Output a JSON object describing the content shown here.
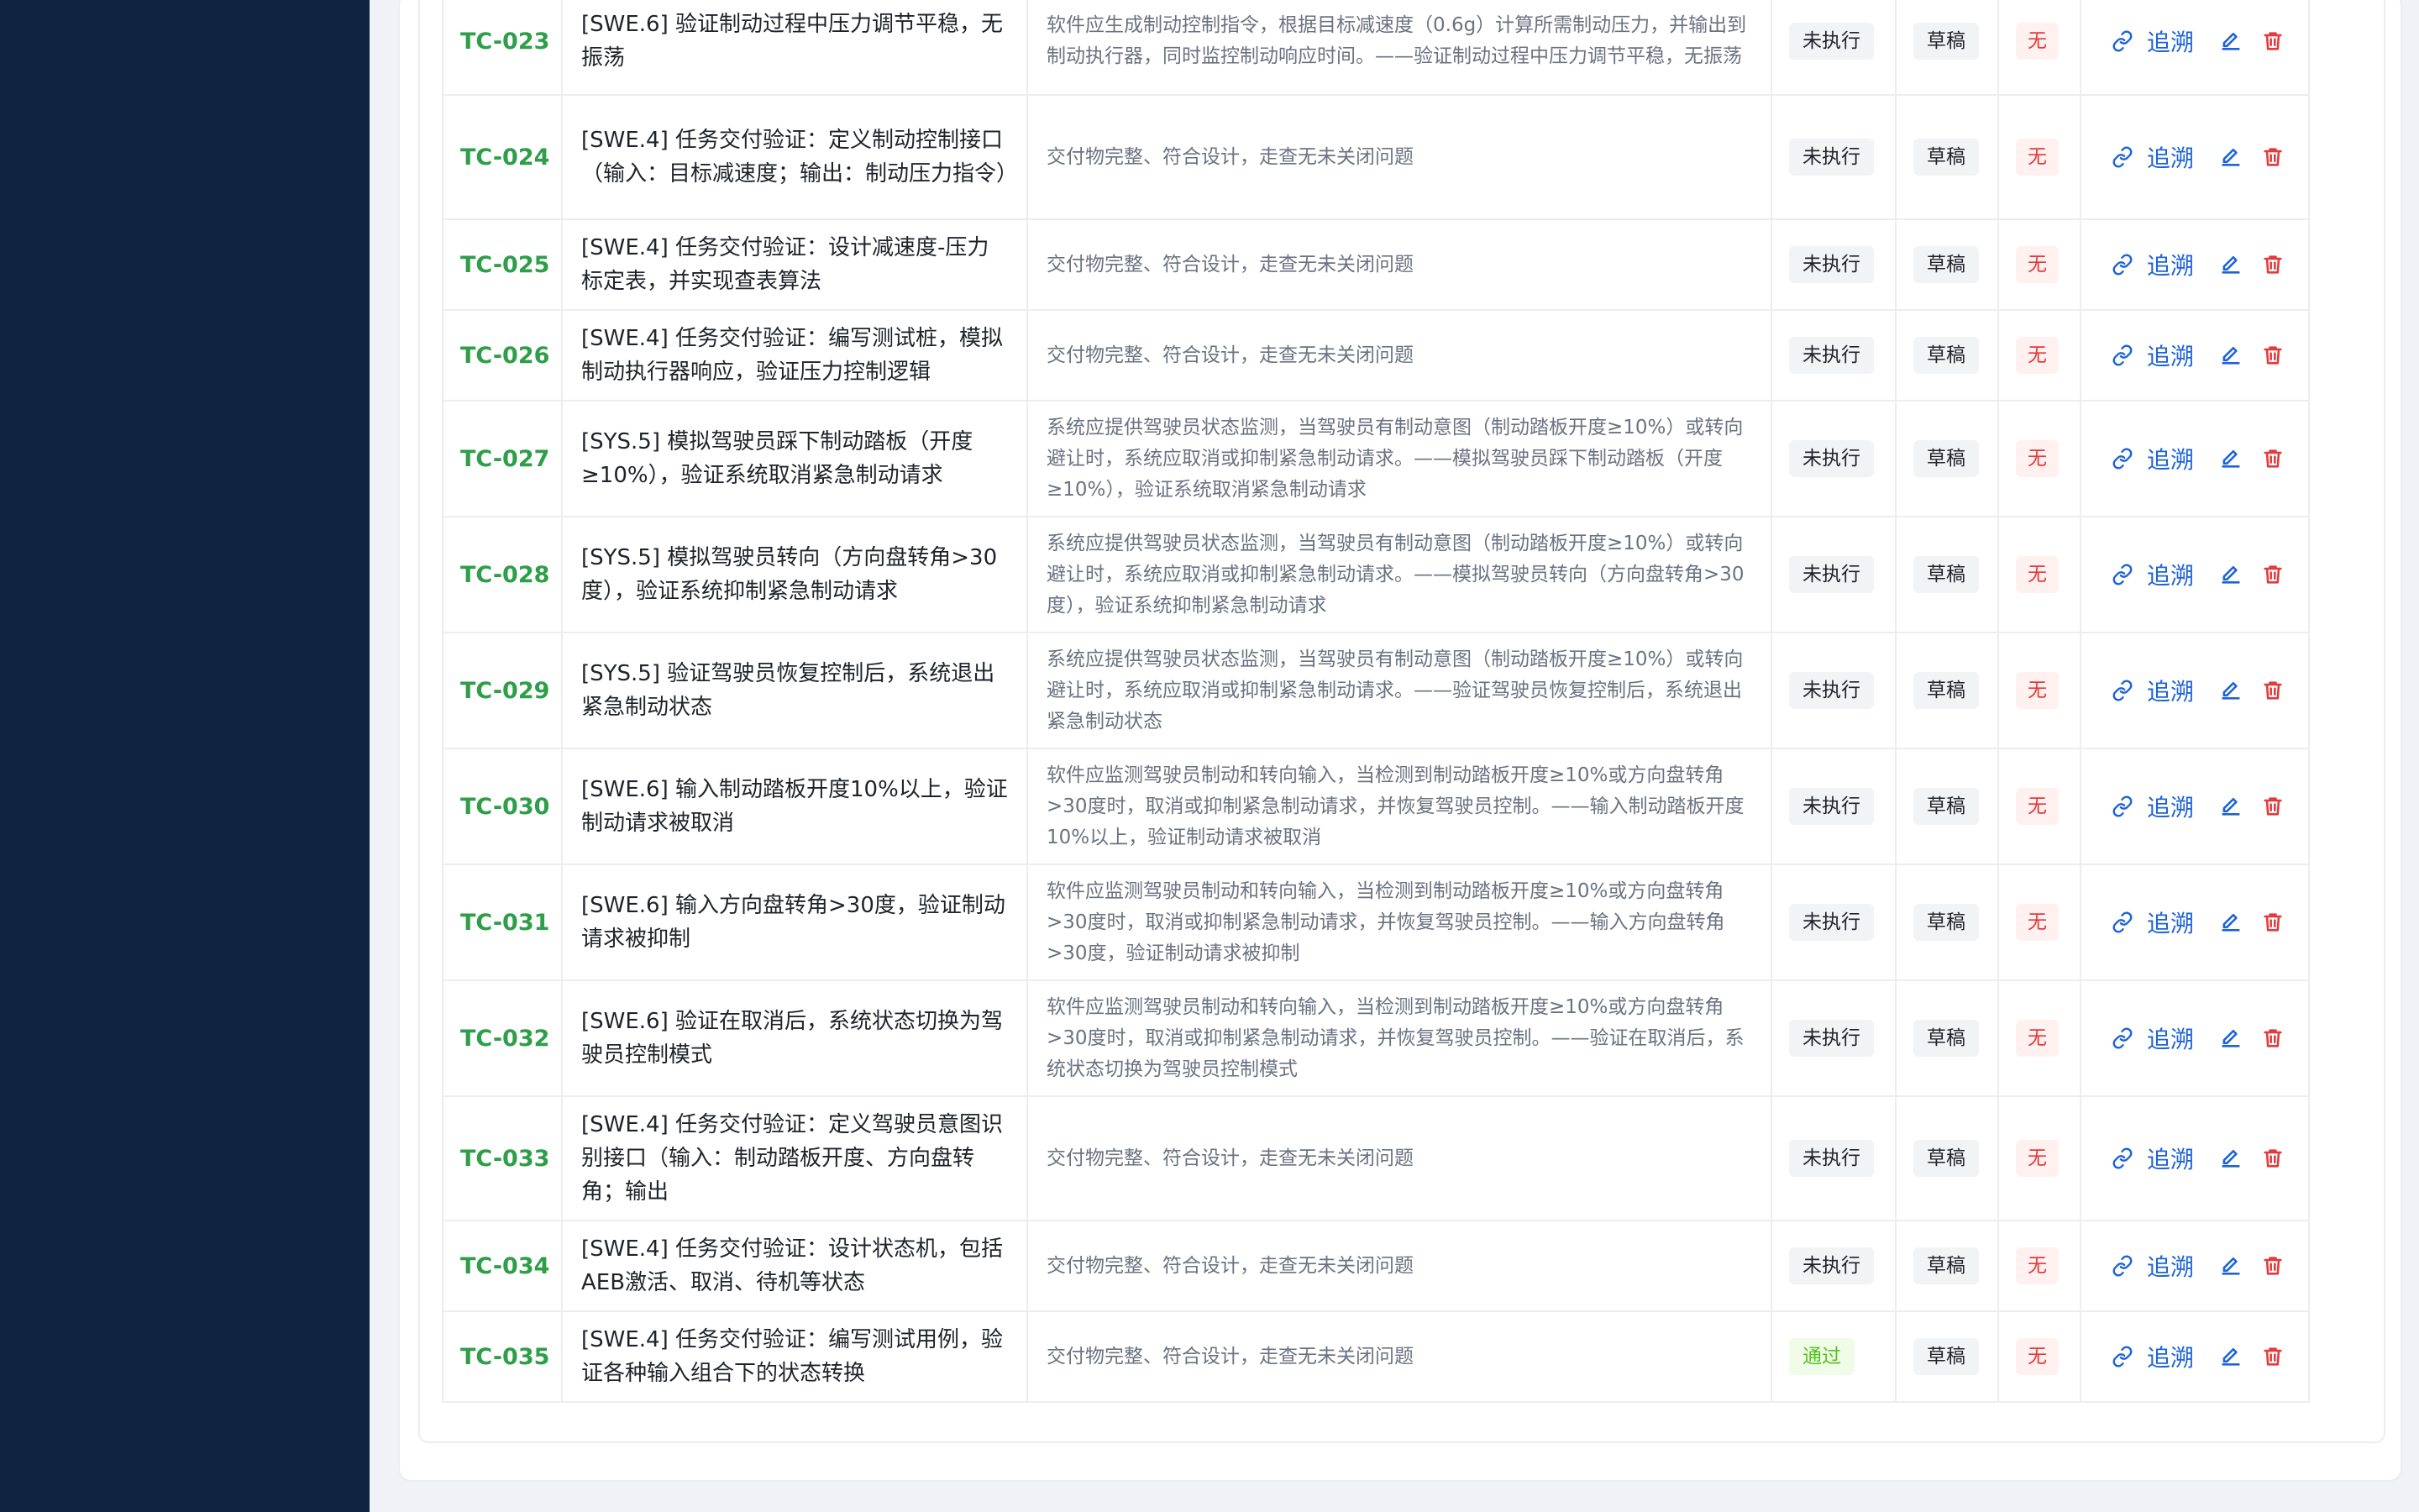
{
  "actions": {
    "trace_label": "追溯"
  },
  "colors": {
    "sidebar": "#0f2440",
    "id_green": "#2e9e48",
    "link_blue": "#1d63d8",
    "delete_red": "#e5393b",
    "pass_green": "#52c41a"
  },
  "rows": [
    {
      "id": "TC-023",
      "title": "[SWE.6] 验证制动过程中压力调节平稳，无振荡",
      "desc": "软件应生成制动控制指令，根据目标减速度（0.6g）计算所需制动压力，并输出到制动执行器，同时监控制动响应时间。——验证制动过程中压力调节平稳，无振荡",
      "status": "未执行",
      "state": "草稿",
      "defect": "无"
    },
    {
      "id": "TC-024",
      "title": "[SWE.4] 任务交付验证：定义制动控制接口（输入：目标减速度；输出：制动压力指令）",
      "desc": "交付物完整、符合设计，走查无未关闭问题",
      "status": "未执行",
      "state": "草稿",
      "defect": "无"
    },
    {
      "id": "TC-025",
      "title": "[SWE.4] 任务交付验证：设计减速度-压力标定表，并实现查表算法",
      "desc": "交付物完整、符合设计，走查无未关闭问题",
      "status": "未执行",
      "state": "草稿",
      "defect": "无"
    },
    {
      "id": "TC-026",
      "title": "[SWE.4] 任务交付验证：编写测试桩，模拟制动执行器响应，验证压力控制逻辑",
      "desc": "交付物完整、符合设计，走查无未关闭问题",
      "status": "未执行",
      "state": "草稿",
      "defect": "无"
    },
    {
      "id": "TC-027",
      "title": "[SYS.5] 模拟驾驶员踩下制动踏板（开度≥10%），验证系统取消紧急制动请求",
      "desc": "系统应提供驾驶员状态监测，当驾驶员有制动意图（制动踏板开度≥10%）或转向避让时，系统应取消或抑制紧急制动请求。——模拟驾驶员踩下制动踏板（开度≥10%），验证系统取消紧急制动请求",
      "status": "未执行",
      "state": "草稿",
      "defect": "无"
    },
    {
      "id": "TC-028",
      "title": "[SYS.5] 模拟驾驶员转向（方向盘转角>30度），验证系统抑制紧急制动请求",
      "desc": "系统应提供驾驶员状态监测，当驾驶员有制动意图（制动踏板开度≥10%）或转向避让时，系统应取消或抑制紧急制动请求。——模拟驾驶员转向（方向盘转角>30度），验证系统抑制紧急制动请求",
      "status": "未执行",
      "state": "草稿",
      "defect": "无"
    },
    {
      "id": "TC-029",
      "title": "[SYS.5] 验证驾驶员恢复控制后，系统退出紧急制动状态",
      "desc": "系统应提供驾驶员状态监测，当驾驶员有制动意图（制动踏板开度≥10%）或转向避让时，系统应取消或抑制紧急制动请求。——验证驾驶员恢复控制后，系统退出紧急制动状态",
      "status": "未执行",
      "state": "草稿",
      "defect": "无"
    },
    {
      "id": "TC-030",
      "title": "[SWE.6] 输入制动踏板开度10%以上，验证制动请求被取消",
      "desc": "软件应监测驾驶员制动和转向输入，当检测到制动踏板开度≥10%或方向盘转角>30度时，取消或抑制紧急制动请求，并恢复驾驶员控制。——输入制动踏板开度10%以上，验证制动请求被取消",
      "status": "未执行",
      "state": "草稿",
      "defect": "无"
    },
    {
      "id": "TC-031",
      "title": "[SWE.6] 输入方向盘转角>30度，验证制动请求被抑制",
      "desc": "软件应监测驾驶员制动和转向输入，当检测到制动踏板开度≥10%或方向盘转角>30度时，取消或抑制紧急制动请求，并恢复驾驶员控制。——输入方向盘转角>30度，验证制动请求被抑制",
      "status": "未执行",
      "state": "草稿",
      "defect": "无"
    },
    {
      "id": "TC-032",
      "title": "[SWE.6] 验证在取消后，系统状态切换为驾驶员控制模式",
      "desc": "软件应监测驾驶员制动和转向输入，当检测到制动踏板开度≥10%或方向盘转角>30度时，取消或抑制紧急制动请求，并恢复驾驶员控制。——验证在取消后，系统状态切换为驾驶员控制模式",
      "status": "未执行",
      "state": "草稿",
      "defect": "无"
    },
    {
      "id": "TC-033",
      "title": "[SWE.4] 任务交付验证：定义驾驶员意图识别接口（输入：制动踏板开度、方向盘转角；输出",
      "desc": "交付物完整、符合设计，走查无未关闭问题",
      "status": "未执行",
      "state": "草稿",
      "defect": "无"
    },
    {
      "id": "TC-034",
      "title": "[SWE.4] 任务交付验证：设计状态机，包括AEB激活、取消、待机等状态",
      "desc": "交付物完整、符合设计，走查无未关闭问题",
      "status": "未执行",
      "state": "草稿",
      "defect": "无"
    },
    {
      "id": "TC-035",
      "title": "[SWE.4] 任务交付验证：编写测试用例，验证各种输入组合下的状态转换",
      "desc": "交付物完整、符合设计，走查无未关闭问题",
      "status": "通过",
      "state": "草稿",
      "defect": "无"
    }
  ]
}
